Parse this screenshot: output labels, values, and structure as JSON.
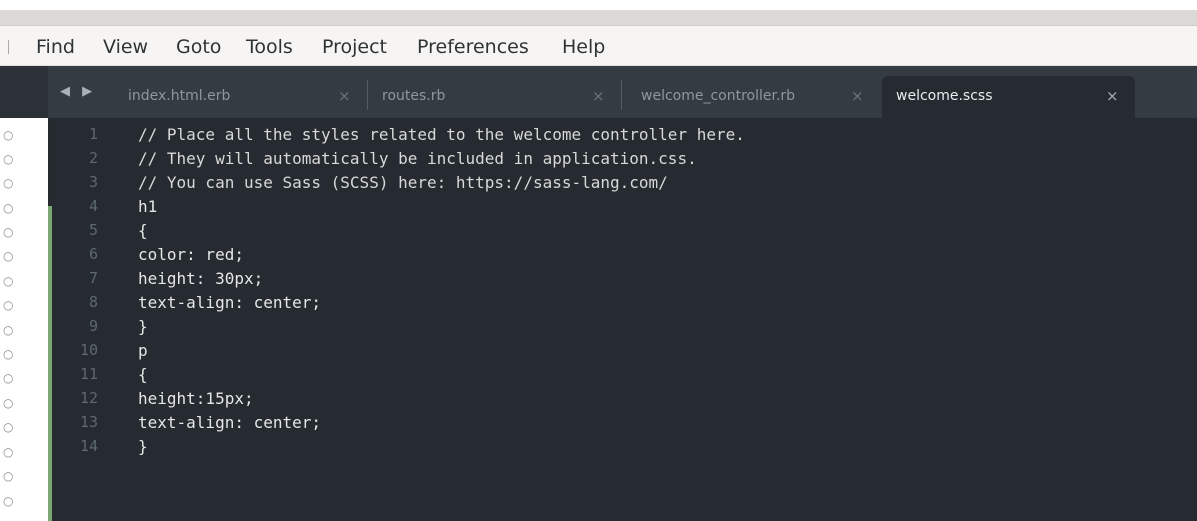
{
  "menu": {
    "items": [
      "Find",
      "View",
      "Goto",
      "Tools",
      "Project",
      "Preferences",
      "Help"
    ]
  },
  "tabs": {
    "nav_label": "◀ ▶",
    "items": [
      {
        "label": "index.html.erb",
        "close": "×",
        "active": false
      },
      {
        "label": "routes.rb",
        "close": "×",
        "active": false
      },
      {
        "label": "welcome_controller.rb",
        "close": "×",
        "active": false
      },
      {
        "label": "welcome.scss",
        "close": "×",
        "active": true
      }
    ]
  },
  "gutter": {
    "fold_marker": "○"
  },
  "editor": {
    "lines": [
      {
        "n": "1",
        "text": "// Place all the styles related to the welcome controller here."
      },
      {
        "n": "2",
        "text": "// They will automatically be included in application.css."
      },
      {
        "n": "3",
        "text": "// You can use Sass (SCSS) here: https://sass-lang.com/"
      },
      {
        "n": "4",
        "text": "h1"
      },
      {
        "n": "5",
        "text": "{"
      },
      {
        "n": "6",
        "text": "color: red;"
      },
      {
        "n": "7",
        "text": "height: 30px;"
      },
      {
        "n": "8",
        "text": "text-align: center;"
      },
      {
        "n": "9",
        "text": "}"
      },
      {
        "n": "10",
        "text": "p"
      },
      {
        "n": "11",
        "text": "{"
      },
      {
        "n": "12",
        "text": "height:15px;"
      },
      {
        "n": "13",
        "text": "text-align: center;"
      },
      {
        "n": "14",
        "text": "}"
      }
    ]
  },
  "colors": {
    "editor_bg": "#262b31",
    "tabbar_bg": "#343b43",
    "diff_added": "#7aa874",
    "line_number": "#5e6871"
  }
}
